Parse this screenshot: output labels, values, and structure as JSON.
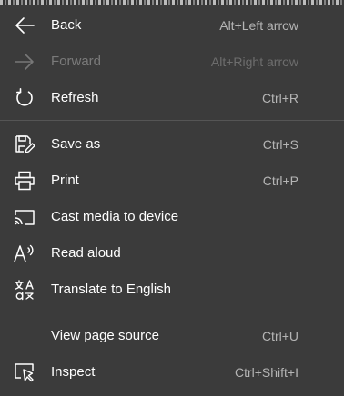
{
  "menu": {
    "items": [
      {
        "label": "Back",
        "shortcut": "Alt+Left arrow",
        "icon": "arrow-left-icon",
        "enabled": true
      },
      {
        "label": "Forward",
        "shortcut": "Alt+Right arrow",
        "icon": "arrow-right-icon",
        "enabled": false
      },
      {
        "label": "Refresh",
        "shortcut": "Ctrl+R",
        "icon": "refresh-icon",
        "enabled": true
      },
      {
        "label": "Save as",
        "shortcut": "Ctrl+S",
        "icon": "save-as-icon",
        "enabled": true
      },
      {
        "label": "Print",
        "shortcut": "Ctrl+P",
        "icon": "printer-icon",
        "enabled": true
      },
      {
        "label": "Cast media to device",
        "shortcut": "",
        "icon": "cast-icon",
        "enabled": true
      },
      {
        "label": "Read aloud",
        "shortcut": "",
        "icon": "read-aloud-icon",
        "enabled": true
      },
      {
        "label": "Translate to English",
        "shortcut": "",
        "icon": "translate-icon",
        "enabled": true
      },
      {
        "label": "View page source",
        "shortcut": "Ctrl+U",
        "icon": "",
        "enabled": true
      },
      {
        "label": "Inspect",
        "shortcut": "Ctrl+Shift+I",
        "icon": "inspect-icon",
        "enabled": true
      }
    ]
  },
  "colors": {
    "background": "#3b3b3b",
    "text": "#ffffff",
    "shortcut_text": "#b5b5b5",
    "disabled_text": "#7a7a7a",
    "divider": "#555555"
  }
}
